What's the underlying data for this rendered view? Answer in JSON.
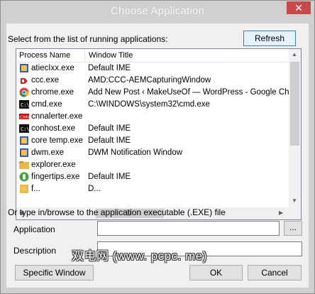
{
  "window": {
    "title": "Choose Application",
    "close_glyph": "✕"
  },
  "prompt_label": "Select from the list of running applications:",
  "refresh_label": "Refresh",
  "list": {
    "headers": [
      "Process Name",
      "Window Title"
    ],
    "rows": [
      {
        "process": "atiecIxx.exe",
        "title": "Default IME",
        "icon": "ati-icon",
        "color": "#3a5ba8"
      },
      {
        "process": "ccc.exe",
        "title": "AMD:CCC-AEMCapturingWindow",
        "icon": "amd-icon",
        "color": "#c62828"
      },
      {
        "process": "chrome.exe",
        "title": "Add New Post ‹ MakeUseOf — WordPress - Google Chrome",
        "icon": "chrome-icon",
        "color": "#4caf50"
      },
      {
        "process": "cmd.exe",
        "title": "C:\\WINDOWS\\system32\\cmd.exe",
        "icon": "console-icon",
        "color": "#111111"
      },
      {
        "process": "cnnalerter.exe",
        "title": "",
        "icon": "cnn-icon",
        "color": "#cc0000"
      },
      {
        "process": "conhost.exe",
        "title": "Default IME",
        "icon": "console-icon",
        "color": "#111111"
      },
      {
        "process": "core temp.exe",
        "title": "Default IME",
        "icon": "app-icon",
        "color": "#3a5ba8"
      },
      {
        "process": "dwm.exe",
        "title": "DWM Notification Window",
        "icon": "app-icon",
        "color": "#3a5ba8"
      },
      {
        "process": "explorer.exe",
        "title": "",
        "icon": "folder-icon",
        "color": "#e8b84a"
      },
      {
        "process": "fingertips.exe",
        "title": "Default IME",
        "icon": "fingertips-icon",
        "color": "#3aa640"
      },
      {
        "process": "f...",
        "title": "D...",
        "icon": "app-icon",
        "color": "#e8b84a"
      }
    ]
  },
  "browse_label": "Or type in/browse to the application executable (.EXE) file",
  "application_label": "Application",
  "application_value": "",
  "browse_button": "...",
  "description_label": "Description",
  "description_value": "",
  "specific_window_label": "Specific Window",
  "ok_label": "OK",
  "cancel_label": "Cancel",
  "watermark": "双电网 (www. pcpc. me)"
}
